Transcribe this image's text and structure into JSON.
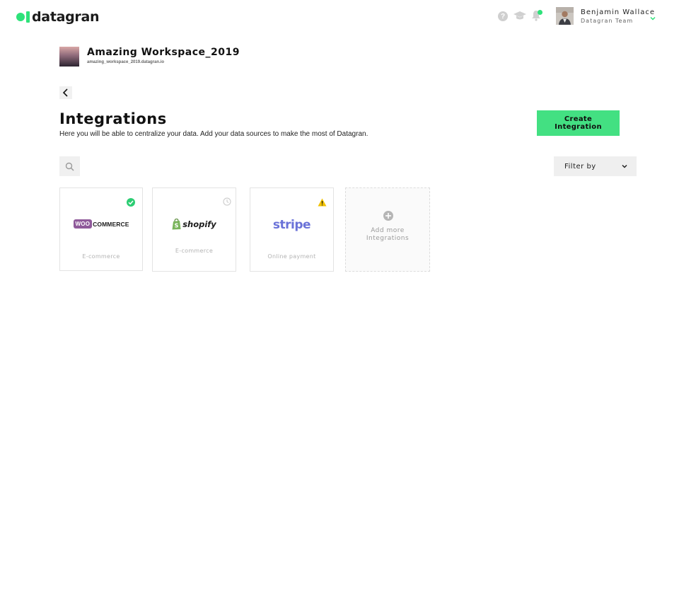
{
  "brand": {
    "name": "datagran",
    "accent": "#2ee27a"
  },
  "header": {
    "help_icon": "help-icon",
    "academy_icon": "graduation-cap-icon",
    "notifications_icon": "bell-icon",
    "user": {
      "name": "Benjamin Wallace",
      "team": "Datagran Team"
    }
  },
  "workspace": {
    "name": "Amazing Workspace_2019",
    "url": "amazing_workspace_2019.datagran.io"
  },
  "page": {
    "title": "Integrations",
    "subtitle": "Here you will be able to centralize your data. Add your data sources to make the most of Datagran.",
    "create_label": "Create Integration",
    "filter_label": "Filter by"
  },
  "integrations": [
    {
      "logo_badge": "WOO",
      "logo_text": "COMMERCE",
      "category": "E-commerce",
      "status": "connected",
      "status_color": "#2ccd73"
    },
    {
      "logo_text": "shopify",
      "category": "E-commerce",
      "status": "pending",
      "status_color": "#d0d0d0"
    },
    {
      "logo_text": "stripe",
      "category": "Online payment",
      "status": "warning",
      "status_color": "#f2c200"
    }
  ],
  "add_more": {
    "line1": "Add more",
    "line2": "Integrations"
  }
}
